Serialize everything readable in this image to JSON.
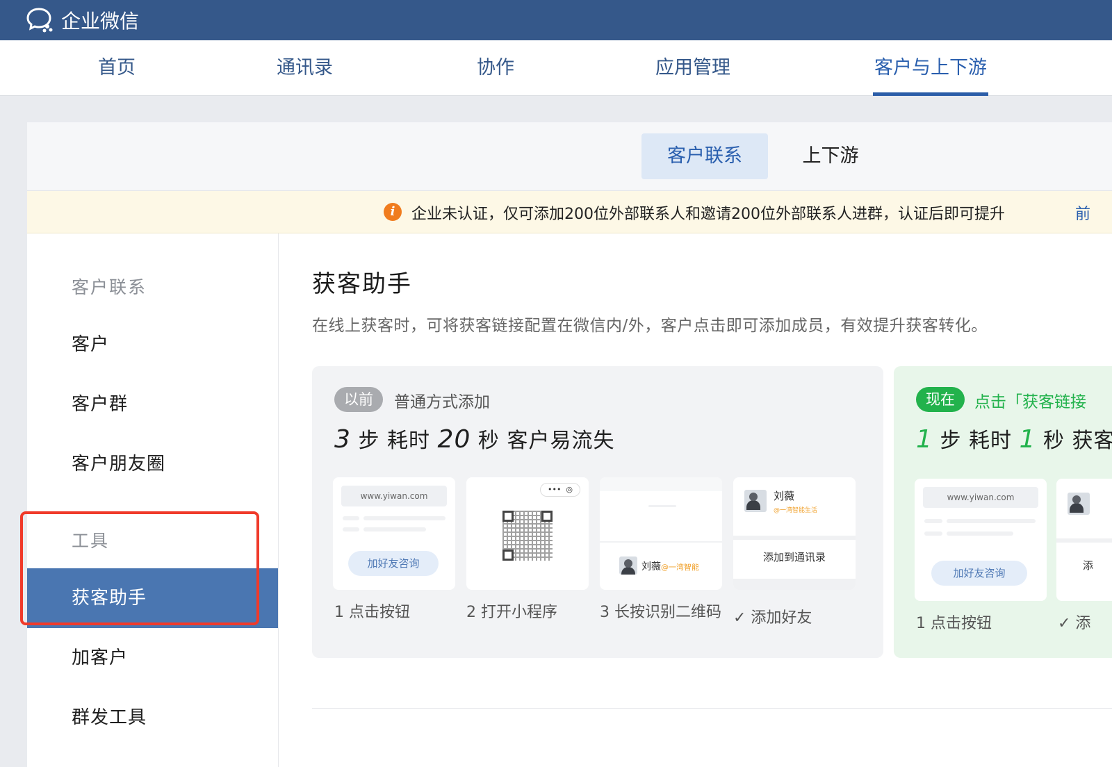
{
  "app": {
    "title": "企业微信"
  },
  "nav": {
    "items": [
      {
        "label": "首页"
      },
      {
        "label": "通讯录"
      },
      {
        "label": "协作"
      },
      {
        "label": "应用管理"
      },
      {
        "label": "客户与上下游"
      }
    ],
    "active_index": 4
  },
  "subtabs": [
    {
      "label": "客户联系"
    },
    {
      "label": "上下游"
    }
  ],
  "notice": {
    "text": "企业未认证，仅可添加200位外部联系人和邀请200位外部联系人进群，认证后即可提升",
    "link": "前"
  },
  "sidebar": {
    "group1": "客户联系",
    "items1": [
      "客户",
      "客户群",
      "客户朋友圈"
    ],
    "group2": "工具",
    "items2": [
      "获客助手",
      "加客户",
      "群发工具"
    ],
    "active": "获客助手"
  },
  "main": {
    "title": "获客助手",
    "description": "在线上获客时，可将获客链接配置在微信内/外，客户点击即可添加成员，有效提升获客转化。",
    "before": {
      "badge": "以前",
      "subtitle": "普通方式添加",
      "head": {
        "n1": "3",
        "t1": "步 耗时",
        "n2": "20",
        "t2": "秒 客户易流失"
      },
      "steps": [
        {
          "label": "1 点击按钮"
        },
        {
          "label": "2 打开小程序"
        },
        {
          "label": "3 长按识别二维码"
        },
        {
          "label": "✓ 添加好友"
        }
      ],
      "url": "www.yiwan.com",
      "button": "加好友咨询",
      "contact_name": "刘薇",
      "contact_tag": "@一湾智能生活",
      "contact_tag_short": "@一湾智能",
      "add_contacts": "添加到通讯录"
    },
    "now": {
      "badge": "现在",
      "subtitle": "点击「获客链接",
      "head": {
        "n1": "1",
        "t1": "步 耗时",
        "n2": "1",
        "t2": "秒 获客"
      },
      "url": "www.yiwan.com",
      "button": "加好友咨询",
      "step1_label": "1 点击按钮",
      "step2_label": "✓ 添",
      "step2_text": "添"
    }
  },
  "colors": {
    "topbar": "#35588a",
    "accent": "#2a5fae",
    "sidebar_active": "#4a76b1",
    "green": "#22b24c",
    "warning": "#f07c1e",
    "highlight_box": "#f03a2a"
  }
}
